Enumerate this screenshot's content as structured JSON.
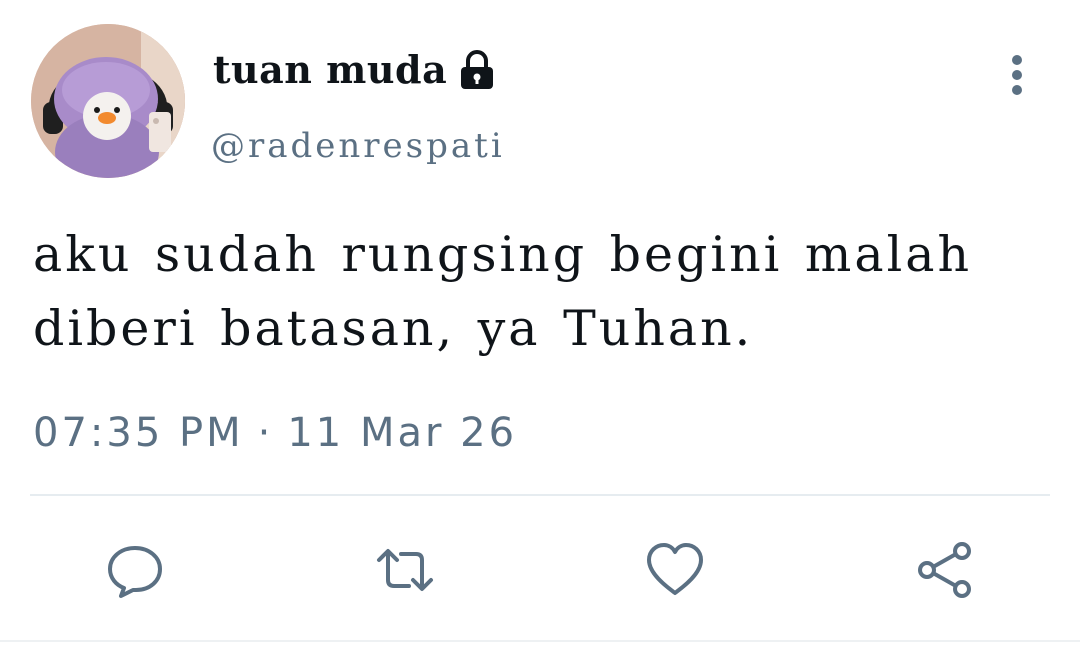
{
  "user": {
    "display_name": "tuan muda",
    "handle": "@radenrespati",
    "protected_icon": "lock-icon",
    "avatar": "avatar"
  },
  "tweet": {
    "text": "aku sudah rungsing begini malah diberi batasan, ya Tuhan.",
    "time": "07:35 PM",
    "separator": "·",
    "date": "11 Mar 26"
  },
  "actions": [
    {
      "name": "reply",
      "icon": "reply-icon"
    },
    {
      "name": "retweet",
      "icon": "retweet-icon"
    },
    {
      "name": "like",
      "icon": "heart-icon"
    },
    {
      "name": "share",
      "icon": "share-icon"
    }
  ],
  "colors": {
    "text_primary": "#0f1419",
    "text_secondary": "#5b7083",
    "divider": "#e6ecf0"
  }
}
